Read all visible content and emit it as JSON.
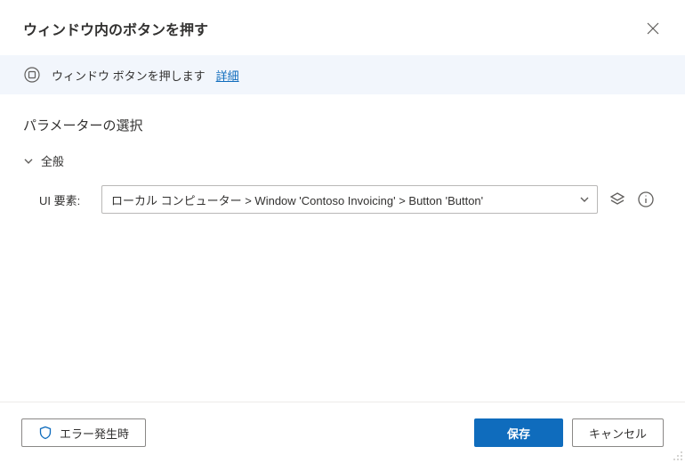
{
  "header": {
    "title": "ウィンドウ内のボタンを押す"
  },
  "banner": {
    "text": "ウィンドウ ボタンを押します",
    "link": "詳細"
  },
  "section": {
    "title": "パラメーターの選択",
    "group": "全般"
  },
  "param": {
    "label": "UI 要素:",
    "value": "ローカル コンピューター > Window 'Contoso Invoicing' > Button 'Button'"
  },
  "footer": {
    "onError": "エラー発生時",
    "save": "保存",
    "cancel": "キャンセル"
  }
}
